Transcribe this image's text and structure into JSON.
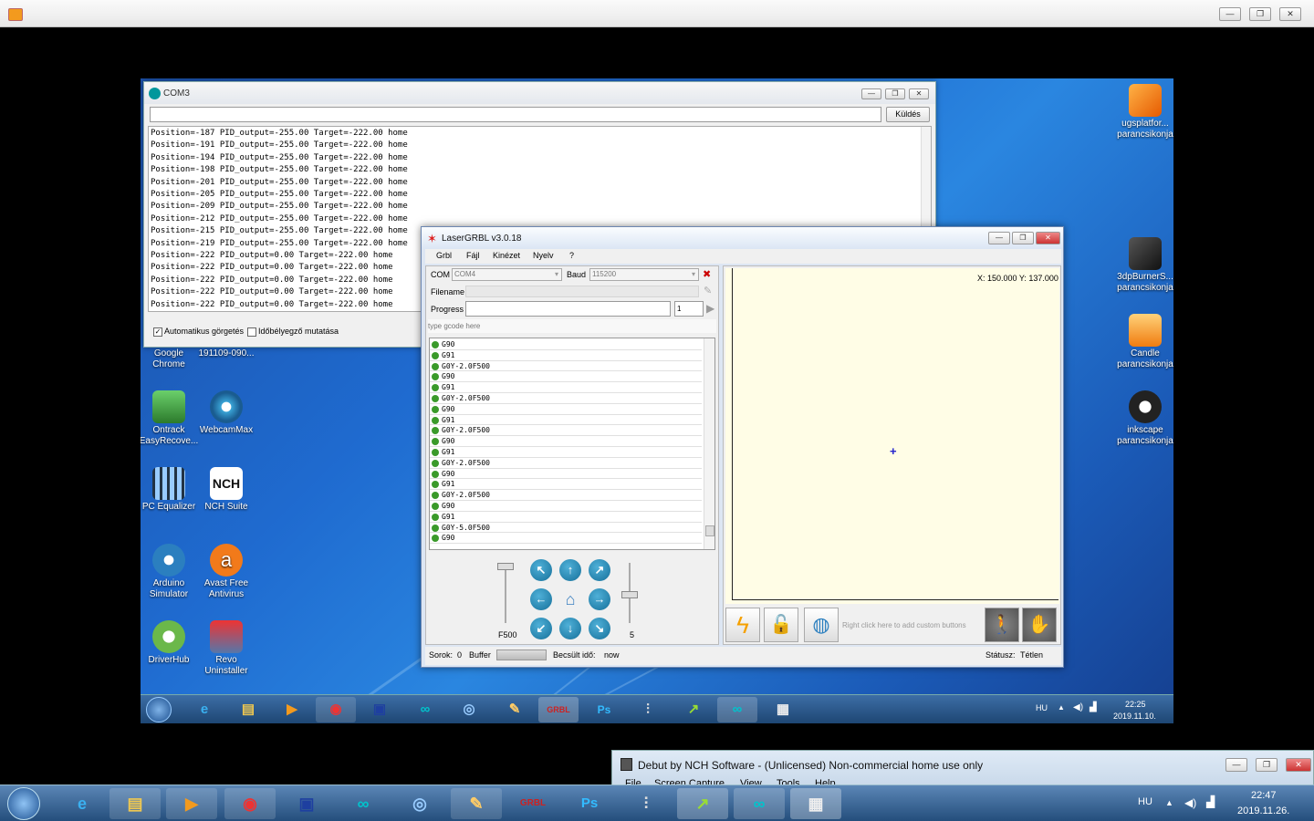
{
  "player": {
    "minimize": "—",
    "maximize": "❐",
    "close": "✕"
  },
  "remote_desktop": {
    "icons_left": [
      {
        "label": "Google Chrome"
      },
      {
        "label": "191109-090..."
      },
      {
        "label": "Ontrack EasyRecove..."
      },
      {
        "label": "WebcamMax"
      },
      {
        "label": "PC Equalizer"
      },
      {
        "label": "NCH Suite"
      },
      {
        "label": "Arduino Simulator"
      },
      {
        "label": "Avast Free Antivirus"
      },
      {
        "label": "DriverHub"
      },
      {
        "label": "Revo Uninstaller"
      }
    ],
    "icons_right": [
      {
        "label": "ugsplatfor... parancsikonja"
      },
      {
        "label": "3dpBurnerS... parancsikonja"
      },
      {
        "label": "Candle parancsikonja"
      },
      {
        "label": "inkscape parancsikonja"
      }
    ],
    "taskbar": {
      "lang": "HU",
      "time": "22:25",
      "date": "2019.11.10."
    }
  },
  "com3": {
    "title": "COM3",
    "send_label": "Küldés",
    "input_value": "",
    "lines": [
      "Position=-187 PID_output=-255.00 Target=-222.00 home",
      "Position=-191 PID_output=-255.00 Target=-222.00 home",
      "Position=-194 PID_output=-255.00 Target=-222.00 home",
      "Position=-198 PID_output=-255.00 Target=-222.00 home",
      "Position=-201 PID_output=-255.00 Target=-222.00 home",
      "Position=-205 PID_output=-255.00 Target=-222.00 home",
      "Position=-209 PID_output=-255.00 Target=-222.00 home",
      "Position=-212 PID_output=-255.00 Target=-222.00 home",
      "Position=-215 PID_output=-255.00 Target=-222.00 home",
      "Position=-219 PID_output=-255.00 Target=-222.00 home",
      "Position=-222 PID_output=0.00 Target=-222.00 home",
      "Position=-222 PID_output=0.00 Target=-222.00 home",
      "Position=-222 PID_output=0.00 Target=-222.00 home",
      "Position=-222 PID_output=0.00 Target=-222.00 home",
      "Position=-222 PID_output=0.00 Target=-222.00 home"
    ],
    "autoscroll_label": "Automatikus görgetés",
    "timestamp_label": "Időbélyegző mutatása"
  },
  "lasergrbl": {
    "title": "LaserGRBL v3.0.18",
    "menu": [
      "Grbl",
      "Fájl",
      "Kinézet",
      "Nyelv",
      "?"
    ],
    "com_label": "COM",
    "com_value": "COM4",
    "baud_label": "Baud",
    "baud_value": "115200",
    "filename_label": "Filename",
    "progress_label": "Progress",
    "progress_count": "1",
    "gcode_placeholder": "type gcode here",
    "gcode_lines": [
      "G90",
      "G91",
      "G0Y-2.0F500",
      "G90",
      "G91",
      "G0Y-2.0F500",
      "G90",
      "G91",
      "G0Y-2.0F500",
      "G90",
      "G91",
      "G0Y-2.0F500",
      "G90",
      "G91",
      "G0Y-2.0F500",
      "G90",
      "G91",
      "G0Y-5.0F500",
      "G90"
    ],
    "speed_label": "F500",
    "step_label": "5",
    "coords": "X: 150.000 Y: 137.000",
    "custom_hint": "Right click here to add custom buttons",
    "status": {
      "rows_label": "Sorok:",
      "rows": "0",
      "buffer_label": "Buffer",
      "est_label": "Becsült idő:",
      "est": "now",
      "state_label": "Státusz:",
      "state": "Tétlen"
    }
  },
  "debut": {
    "title": "Debut by NCH Software - (Unlicensed) Non-commercial home use only",
    "menu": [
      "File",
      "Screen Capture",
      "View",
      "Tools",
      "Help"
    ]
  },
  "taskbar": {
    "lang": "HU",
    "time": "22:47",
    "date": "2019.11.26."
  },
  "colors": {
    "accent": "#1f6bd0",
    "canvas": "#fffde6"
  }
}
